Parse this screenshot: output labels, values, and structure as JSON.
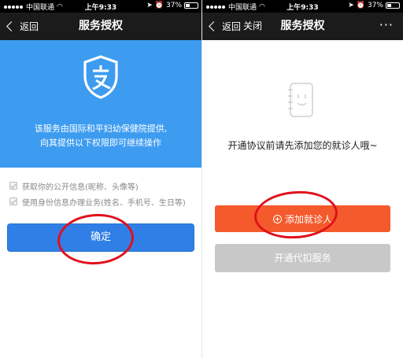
{
  "left": {
    "status": {
      "carrier": "中国联通",
      "time": "上午9:33",
      "battery": "37%"
    },
    "nav": {
      "back_label": "返回",
      "title": "服务授权"
    },
    "panel": {
      "line1": "该服务由国际和平妇幼保健院提供,",
      "line2": "向其提供以下权限即可继续操作"
    },
    "permissions": [
      {
        "label": "获取你的公开信息(昵称、头像等)"
      },
      {
        "label": "使用身份信息办理业务(姓名、手机号、生日等)"
      }
    ],
    "confirm_label": "确定"
  },
  "right": {
    "status": {
      "carrier": "中国联通",
      "time": "上午9:33",
      "battery": "37%"
    },
    "nav": {
      "back_label": "返回",
      "close_label": "关闭",
      "title": "服务授权",
      "more_label": "···"
    },
    "prompt": "开通协议前请先添加您的就诊人哦~",
    "add_label": "添加就诊人",
    "deduct_label": "开通代扣服务"
  },
  "colors": {
    "panel_blue": "#3d9cf0",
    "confirm_blue": "#2f7fe6",
    "add_orange": "#f55a2c",
    "disabled_gray": "#c8c8c8",
    "annotation_red": "#e0101c"
  }
}
